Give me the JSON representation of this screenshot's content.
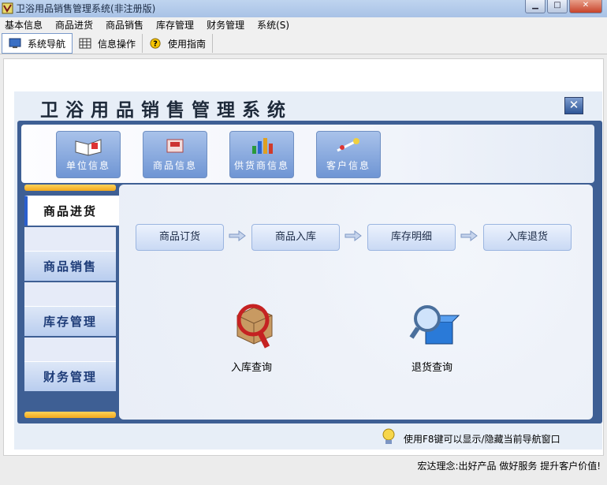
{
  "window": {
    "title": "卫浴用品销售管理系统(非注册版)",
    "min_label": "▁",
    "max_label": "□",
    "close_label": "✕"
  },
  "menu": [
    "基本信息",
    "商品进货",
    "商品销售",
    "库存管理",
    "财务管理",
    "系统(S)"
  ],
  "toolbar": [
    {
      "label": "系统导航",
      "icon": "monitor-icon"
    },
    {
      "label": "信息操作",
      "icon": "grid-icon"
    },
    {
      "label": "使用指南",
      "icon": "help-icon"
    }
  ],
  "panel": {
    "title": "卫浴用品销售管理系统",
    "close_label": "✕"
  },
  "quick_buttons": [
    {
      "label": "单位信息",
      "icon": "book-icon"
    },
    {
      "label": "商品信息",
      "icon": "product-icon"
    },
    {
      "label": "供货商信息",
      "icon": "chart-icon"
    },
    {
      "label": "客户信息",
      "icon": "customer-icon"
    }
  ],
  "side_nav": [
    "商品进货",
    "商品销售",
    "库存管理",
    "财务管理"
  ],
  "steps": [
    "商品订货",
    "商品入库",
    "库存明细",
    "入库退货"
  ],
  "queries": [
    {
      "label": "入库查询",
      "icon": "inbound-search-icon"
    },
    {
      "label": "退货查询",
      "icon": "return-search-icon"
    }
  ],
  "status_hint": "使用F8键可以显示/隐藏当前导航窗口",
  "footer_slogan": "宏达理念:出好产品  做好服务  提升客户价值!",
  "colors": {
    "frame_blue": "#3e5f94",
    "accent_orange": "#f2a81c",
    "button_blue": "#6f95d4"
  }
}
